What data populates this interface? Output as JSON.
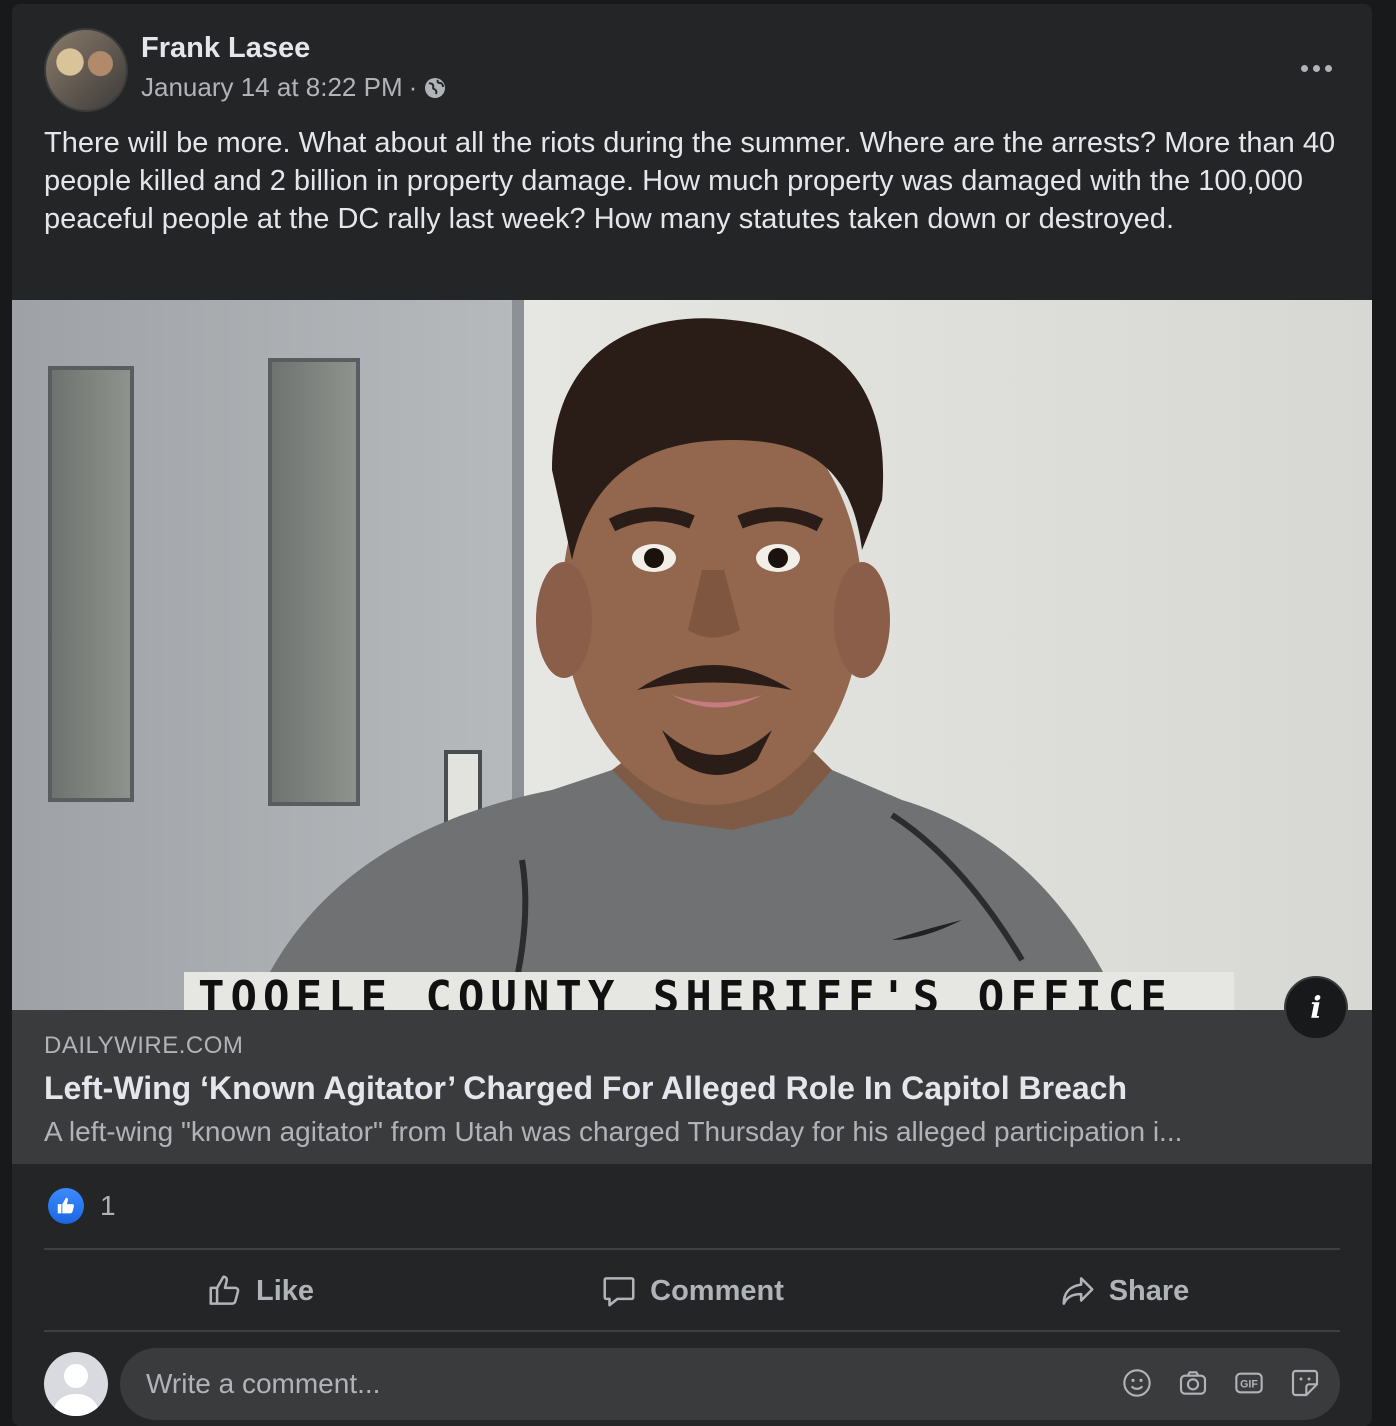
{
  "post": {
    "author": "Frank Lasee",
    "timestamp": "January 14 at 8:22 PM",
    "separator": "·",
    "privacy_icon": "globe-icon",
    "body": "There will be more. What about all the riots during the summer. Where are the arrests? More than 40 people killed and 2 billion in property damage. How much property was damaged with the 100,000 peaceful people at the DC rally last week? How many statutes taken down or destroyed."
  },
  "media": {
    "caption": "TOOELE COUNTY SHERIFF'S OFFICE",
    "info_label": "i"
  },
  "link_preview": {
    "domain": "DAILYWIRE.COM",
    "title": "Left-Wing ‘Known Agitator’ Charged For Alleged Role In Capitol Breach",
    "description": "A left-wing \"known agitator\" from Utah was charged Thursday for his alleged participation i..."
  },
  "reactions": {
    "icon": "thumbs-up-icon",
    "count": "1"
  },
  "actions": {
    "like": "Like",
    "comment": "Comment",
    "share": "Share"
  },
  "comment_box": {
    "placeholder": "Write a comment...",
    "icons": [
      "emoji-icon",
      "camera-icon",
      "gif-icon",
      "sticker-icon"
    ]
  },
  "colors": {
    "background": "#18191a",
    "card": "#242526",
    "input": "#3a3b3c",
    "text_primary": "#e4e6eb",
    "text_secondary": "#b0b3b8",
    "like_blue": "#1b74e4"
  }
}
